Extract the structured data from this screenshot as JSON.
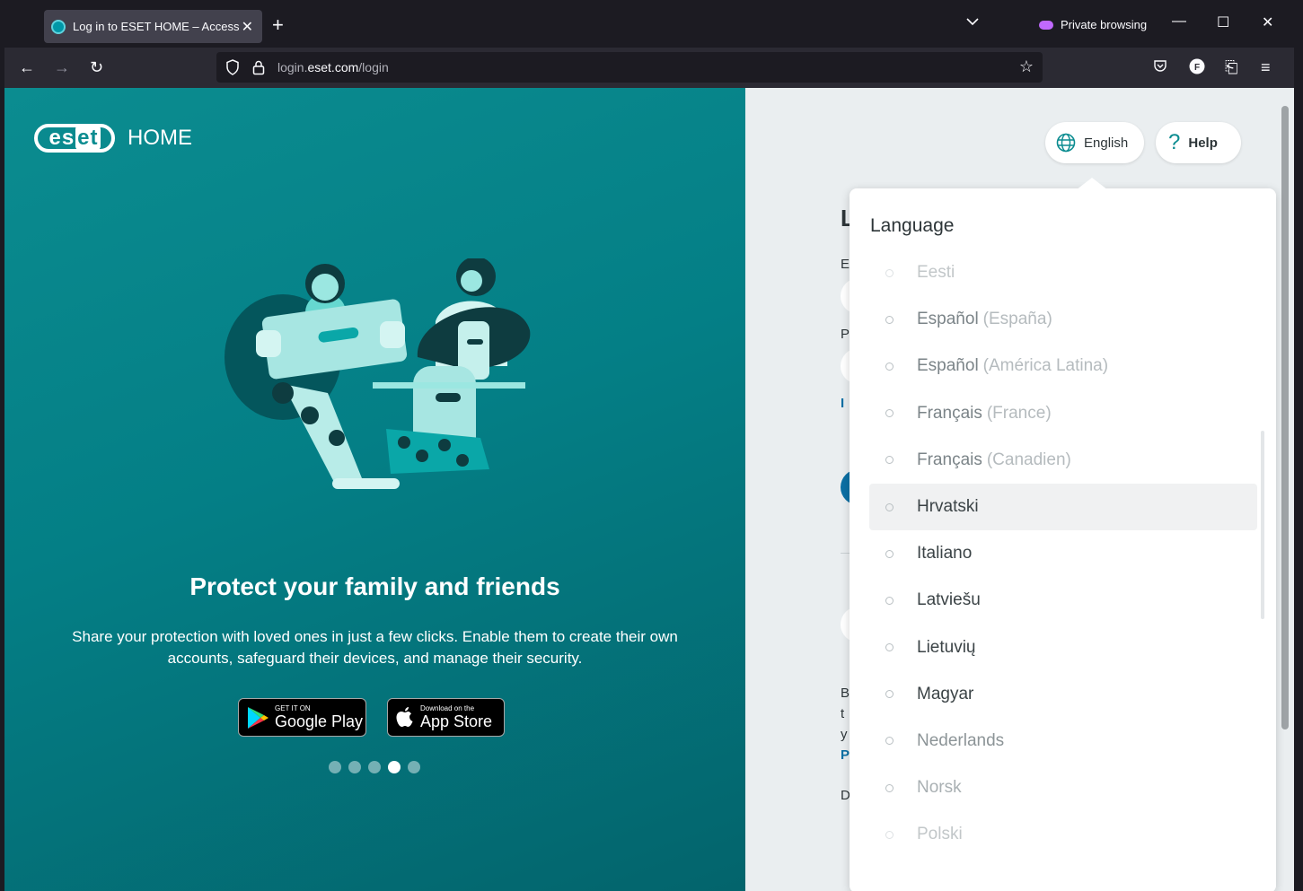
{
  "browser": {
    "tab_title": "Log in to ESET HOME – Access &",
    "private_label": "Private browsing",
    "url_prefix": "login.",
    "url_domain": "eset.com",
    "url_path": "/login"
  },
  "left_panel": {
    "logo_text": "eset",
    "logo_suffix": "HOME",
    "slide_title": "Protect your family and friends",
    "slide_text": "Share your protection with loved ones in just a few clicks. Enable them to create their own accounts, safeguard their devices, and manage their security.",
    "google_small": "GET IT ON",
    "google_big": "Google Play",
    "apple_small": "Download on the",
    "apple_big": "App Store",
    "carousel_active_index": 3
  },
  "header": {
    "language_label": "English",
    "help_label": "Help"
  },
  "popover": {
    "title": "Language",
    "languages": [
      {
        "name": "Eesti",
        "region": ""
      },
      {
        "name": "Español",
        "region": "(España)"
      },
      {
        "name": "Español",
        "region": "(América Latina)"
      },
      {
        "name": "Français",
        "region": "(France)"
      },
      {
        "name": "Français",
        "region": "(Canadien)"
      },
      {
        "name": "Hrvatski",
        "region": ""
      },
      {
        "name": "Italiano",
        "region": ""
      },
      {
        "name": "Latviešu",
        "region": ""
      },
      {
        "name": "Lietuvių",
        "region": ""
      },
      {
        "name": "Magyar",
        "region": ""
      },
      {
        "name": "Nederlands",
        "region": ""
      },
      {
        "name": "Norsk",
        "region": ""
      },
      {
        "name": "Polski",
        "region": ""
      }
    ]
  },
  "hidden_form_letters": [
    "L",
    "E",
    "P",
    "I",
    "B",
    "t",
    "y",
    "P",
    "D"
  ],
  "colors": {
    "brand_teal": "#0b8c90",
    "link_blue": "#0b6fa4"
  }
}
